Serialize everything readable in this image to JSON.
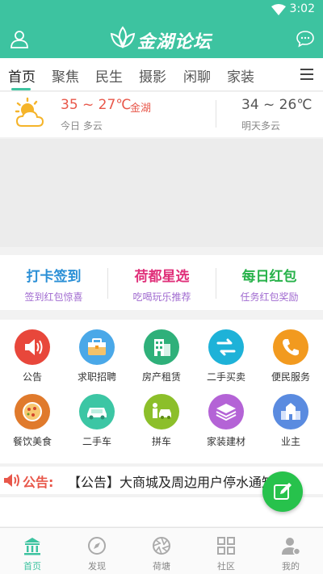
{
  "status": {
    "time": "3:02"
  },
  "header": {
    "logo_text": "金湖论坛"
  },
  "tabs": [
    {
      "label": "首页"
    },
    {
      "label": "聚焦"
    },
    {
      "label": "民生"
    },
    {
      "label": "摄影"
    },
    {
      "label": "闲聊"
    },
    {
      "label": "家装"
    }
  ],
  "weather": {
    "today_temp": "35 ~ 27℃",
    "city": "金湖",
    "today_desc": "今日 多云",
    "tomorrow_temp": "34 ~ 26℃",
    "tomorrow_desc": "明天多云"
  },
  "promos": [
    {
      "title": "打卡签到",
      "sub": "签到红包惊喜",
      "color": "#2a8fd6"
    },
    {
      "title": "荷都星选",
      "sub": "吃喝玩乐推荐",
      "color": "#e0307a"
    },
    {
      "title": "每日红包",
      "sub": "任务红包奖励",
      "color": "#27b24a"
    }
  ],
  "grid": [
    {
      "label": "公告",
      "icon": "speaker-icon",
      "color": "#e8473b"
    },
    {
      "label": "求职招聘",
      "icon": "briefcase-icon",
      "color": "#4aa8e8"
    },
    {
      "label": "房产租赁",
      "icon": "building-icon",
      "color": "#2fb07a"
    },
    {
      "label": "二手买卖",
      "icon": "exchange-icon",
      "color": "#1eb2d8"
    },
    {
      "label": "便民服务",
      "icon": "phone-icon",
      "color": "#f29a1f"
    },
    {
      "label": "餐饮美食",
      "icon": "pizza-icon",
      "color": "#e07a2c"
    },
    {
      "label": "二手车",
      "icon": "car-icon",
      "color": "#3cc6a4"
    },
    {
      "label": "拼车",
      "icon": "carpool-icon",
      "color": "#8cbf2a"
    },
    {
      "label": "家装建材",
      "icon": "layers-icon",
      "color": "#b463d6"
    },
    {
      "label": "业主",
      "icon": "community-icon",
      "color": "#5a8be0"
    }
  ],
  "notice": {
    "label": "公告:",
    "text": "【公告】大商城及周边用户停水通知"
  },
  "nav": [
    {
      "label": "首页",
      "icon": "home-temple-icon"
    },
    {
      "label": "发现",
      "icon": "compass-icon"
    },
    {
      "label": "荷塘",
      "icon": "aperture-icon"
    },
    {
      "label": "社区",
      "icon": "grid-icon"
    },
    {
      "label": "我的",
      "icon": "profile-icon"
    }
  ],
  "colors": {
    "brand": "#3dc3a0",
    "accent_red": "#e8574a",
    "fab": "#27c24c"
  }
}
